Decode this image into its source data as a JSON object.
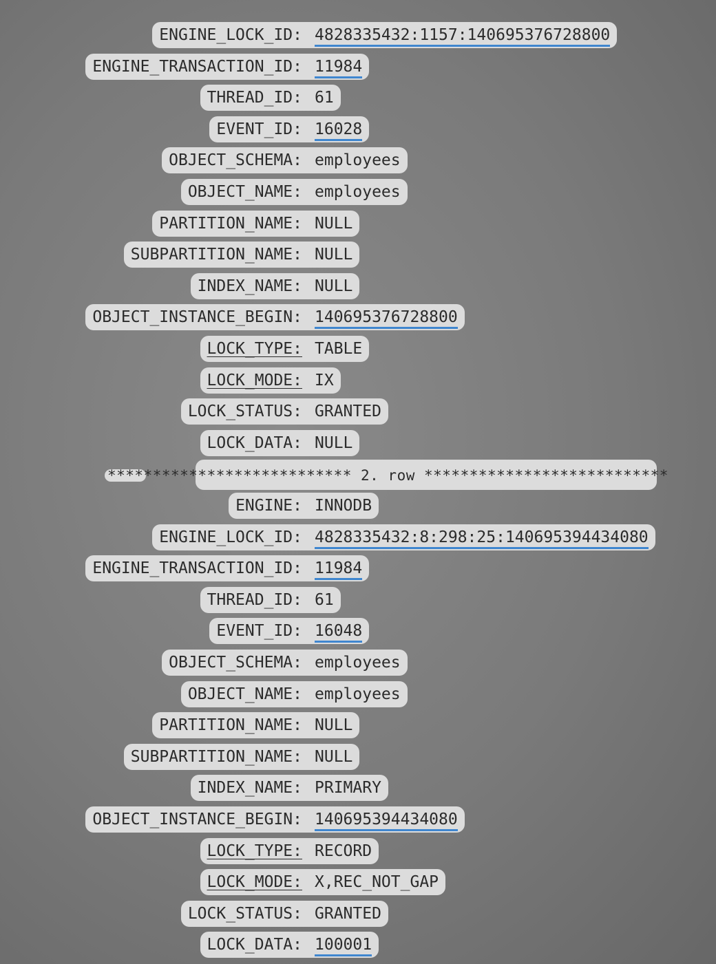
{
  "row1": [
    {
      "key": "ENGINE_LOCK_ID:",
      "value": "4828335432:1157:140695376728800",
      "underline_value": true
    },
    {
      "key": "ENGINE_TRANSACTION_ID:",
      "value": "11984",
      "underline_value": true
    },
    {
      "key": "THREAD_ID:",
      "value": "61"
    },
    {
      "key": "EVENT_ID:",
      "value": "16028",
      "underline_value": true
    },
    {
      "key": "OBJECT_SCHEMA:",
      "value": "employees"
    },
    {
      "key": "OBJECT_NAME:",
      "value": "employees"
    },
    {
      "key": "PARTITION_NAME:",
      "value": "NULL"
    },
    {
      "key": "SUBPARTITION_NAME:",
      "value": "NULL"
    },
    {
      "key": "INDEX_NAME:",
      "value": "NULL"
    },
    {
      "key": "OBJECT_INSTANCE_BEGIN:",
      "value": "140695376728800",
      "underline_value": true
    },
    {
      "key": "LOCK_TYPE:",
      "value": "TABLE",
      "underline_key": true
    },
    {
      "key": "LOCK_MODE:",
      "value": "IX",
      "underline_key": true
    },
    {
      "key": "LOCK_STATUS:",
      "value": "GRANTED"
    },
    {
      "key": "LOCK_DATA:",
      "value": "NULL"
    }
  ],
  "separator": "*************************** 2. row ***************************",
  "row2": [
    {
      "key": "ENGINE:",
      "value": "INNODB"
    },
    {
      "key": "ENGINE_LOCK_ID:",
      "value": "4828335432:8:298:25:140695394434080",
      "underline_value": true
    },
    {
      "key": "ENGINE_TRANSACTION_ID:",
      "value": "11984",
      "underline_value": true
    },
    {
      "key": "THREAD_ID:",
      "value": "61"
    },
    {
      "key": "EVENT_ID:",
      "value": "16048",
      "underline_value": true
    },
    {
      "key": "OBJECT_SCHEMA:",
      "value": "employees"
    },
    {
      "key": "OBJECT_NAME:",
      "value": "employees"
    },
    {
      "key": "PARTITION_NAME:",
      "value": "NULL"
    },
    {
      "key": "SUBPARTITION_NAME:",
      "value": "NULL"
    },
    {
      "key": "INDEX_NAME:",
      "value": "PRIMARY"
    },
    {
      "key": "OBJECT_INSTANCE_BEGIN:",
      "value": "140695394434080",
      "underline_value": true
    },
    {
      "key": "LOCK_TYPE:",
      "value": "RECORD",
      "underline_key": true
    },
    {
      "key": "LOCK_MODE:",
      "value": "X,REC_NOT_GAP",
      "underline_key": true
    },
    {
      "key": "LOCK_STATUS:",
      "value": "GRANTED"
    },
    {
      "key": "LOCK_DATA:",
      "value": "100001",
      "underline_value": true
    }
  ]
}
